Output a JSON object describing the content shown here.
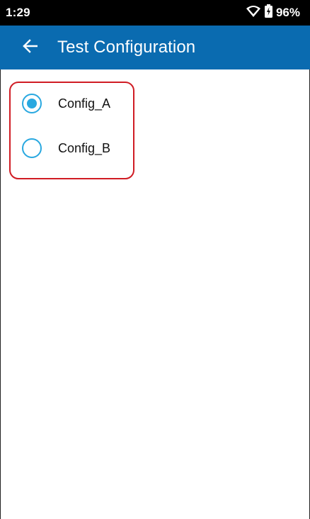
{
  "status_bar": {
    "time": "1:29",
    "battery_percent": "96%",
    "icons": [
      "wifi-icon",
      "battery-icon"
    ]
  },
  "app_bar": {
    "title": "Test Configuration",
    "back_icon": "arrow-left-icon",
    "background_color": "#0a6bb0"
  },
  "config_list": {
    "items": [
      {
        "label": "Config_A",
        "selected": true
      },
      {
        "label": "Config_B",
        "selected": false
      }
    ],
    "radio_color": "#29a8e0",
    "highlight_color": "#d01c24"
  }
}
